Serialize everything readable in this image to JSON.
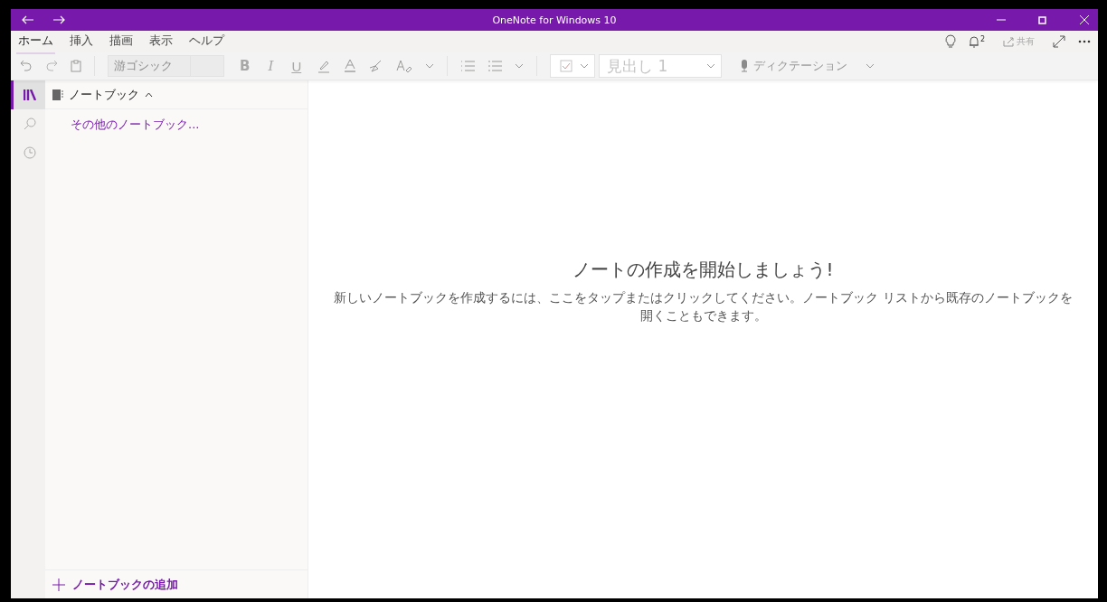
{
  "window": {
    "title": "OneNote for Windows 10",
    "notification_count": "2",
    "share_label": "共有"
  },
  "tabs": [
    {
      "label": "ホーム",
      "selected": true
    },
    {
      "label": "挿入",
      "selected": false
    },
    {
      "label": "描画",
      "selected": false
    },
    {
      "label": "表示",
      "selected": false
    },
    {
      "label": "ヘルプ",
      "selected": false
    }
  ],
  "toolbar": {
    "disabled": true,
    "font": "游ゴシック",
    "bold": "B",
    "italic": "I",
    "underline": "U",
    "style": "見出し 1",
    "dictation": "ディクテーション"
  },
  "rail": [
    {
      "kind": "notebooks",
      "selected": true
    },
    {
      "kind": "search",
      "selected": false
    },
    {
      "kind": "recent",
      "selected": false
    }
  ],
  "sidebar": {
    "header": "ノートブック",
    "expanded": true,
    "items": [
      "その他のノートブック..."
    ],
    "add_label": "ノートブックの追加"
  },
  "main": {
    "heading": "ノートの作成を開始しましょう!",
    "message": "新しいノートブックを作成するには、ここをタップまたはクリックしてください。ノートブック リストから既存のノートブックを開くこともできます。"
  }
}
